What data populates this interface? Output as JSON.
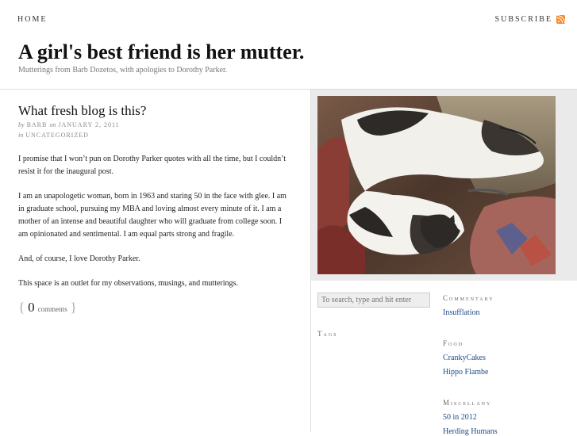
{
  "nav": {
    "home_label": "HOME",
    "subscribe_label": "SUBSCRIBE",
    "rss_icon": "rss-icon",
    "rss_color": "#f58a2c"
  },
  "site": {
    "title": "A girl's best friend is her mutter.",
    "tagline": "Mutterings from Barb Dozetos, with apologies to Dorothy Parker."
  },
  "post": {
    "title": "What fresh blog is this?",
    "by_prefix": "by",
    "author": "BARB",
    "on_prefix": "on",
    "date": "JANUARY 2, 2011",
    "in_prefix": "in",
    "category": "UNCATEGORIZED",
    "paragraphs": [
      "I promise that I won’t pun on Dorothy Parker quotes with all the time, but I couldn’t resist it for the inaugural post.",
      "I am an unapologetic woman, born in 1963 and staring 50 in the face with glee. I am in graduate school, pursuing my MBA and loving almost every minute of it. I am a mother of an intense and beautiful daughter who will graduate from college soon. I am opinionated and sentimental. I am equal parts strong and fragile.",
      "And, of course, I love Dorothy Parker.",
      "This space is an outlet for my observations, musings, and mutterings."
    ],
    "comments_open": "{",
    "comments_count": "0",
    "comments_label": "comments",
    "comments_close": "}"
  },
  "sidebar": {
    "search_placeholder": "To search, type and hit enter",
    "tags_heading": "Tags",
    "sections": [
      {
        "heading": "Commentary",
        "links": [
          "Insufflation"
        ]
      },
      {
        "heading": "Food",
        "links": [
          "CrankyCakes",
          "Hippo Flambe"
        ]
      },
      {
        "heading": "Miscellany",
        "links": [
          "50 in 2012",
          "Herding Humans"
        ]
      }
    ],
    "link_color": "#1a4a8a"
  }
}
